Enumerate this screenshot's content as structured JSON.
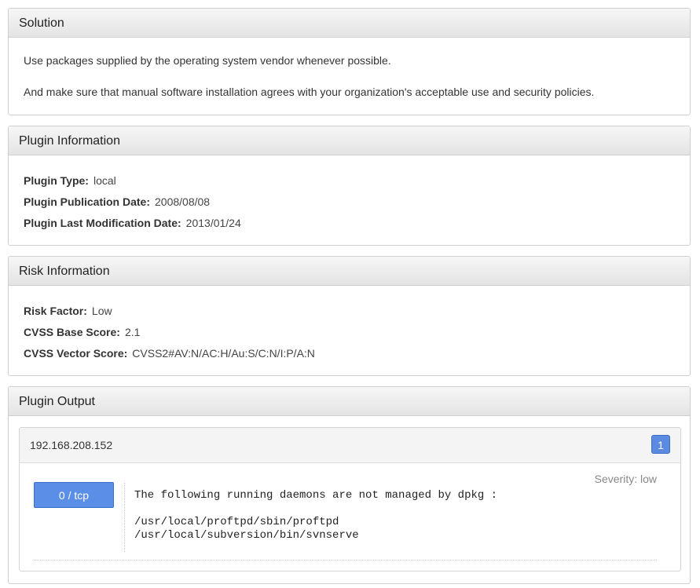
{
  "solution": {
    "title": "Solution",
    "lines": [
      "Use packages supplied by the operating system vendor whenever possible.",
      "And make sure that manual software installation agrees with your organization's acceptable use and security policies."
    ]
  },
  "plugin_info": {
    "title": "Plugin Information",
    "rows": [
      {
        "key": "Plugin Type:",
        "value": "local"
      },
      {
        "key": "Plugin Publication Date:",
        "value": "2008/08/08"
      },
      {
        "key": "Plugin Last Modification Date:",
        "value": "2013/01/24"
      }
    ]
  },
  "risk_info": {
    "title": "Risk Information",
    "rows": [
      {
        "key": "Risk Factor:",
        "value": "Low"
      },
      {
        "key": "CVSS Base Score:",
        "value": "2.1"
      },
      {
        "key": "CVSS Vector Score:",
        "value": "CVSS2#AV:N/AC:H/Au:S/C:N/I:P/A:N"
      }
    ]
  },
  "plugin_output": {
    "title": "Plugin Output",
    "host": {
      "ip": "192.168.208.152",
      "count": "1",
      "port_label": "0 / tcp",
      "severity": "Severity: low",
      "output": "The following running daemons are not managed by dpkg :\n\n/usr/local/proftpd/sbin/proftpd\n/usr/local/subversion/bin/svnserve"
    }
  },
  "colors": {
    "accent_blue": "#5b8ee6",
    "header_gradient_top": "#f6f6f6",
    "header_gradient_bottom": "#e4e4e4"
  }
}
